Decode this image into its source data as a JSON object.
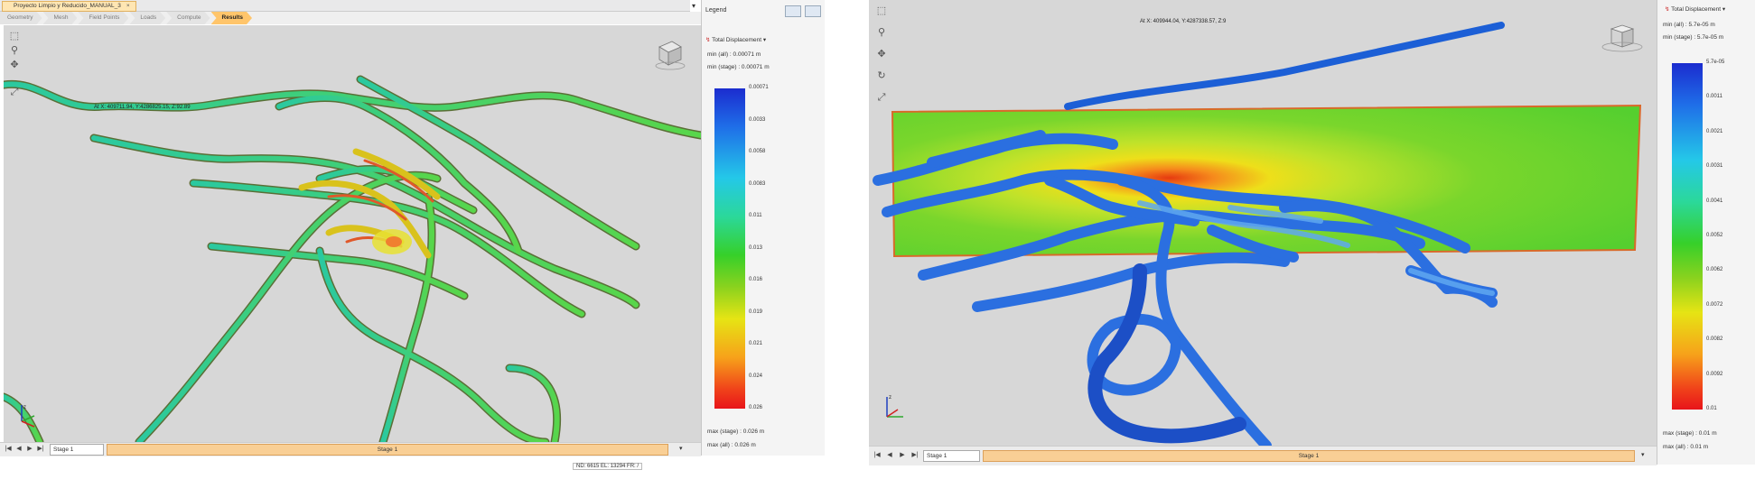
{
  "left": {
    "doc_tab": "Proyecto Limpio y Reducido_MANUAL_3",
    "doc_tab_close": "×",
    "workflow_tabs": [
      "Geometry",
      "Mesh",
      "Field Points",
      "Loads",
      "Compute",
      "Results"
    ],
    "active_tab": "Results",
    "coord_readout": "At X: 409711.94, Y:4286825.15, Z:92.89",
    "legend": {
      "title": "Legend",
      "quantity": "Total Displacement",
      "min_all": "min (all) :   0.00071 m",
      "min_stage": "min (stage) :  0.00071 m",
      "max_stage": "max (stage) :  0.026 m",
      "max_all": "max (all) :   0.026 m",
      "ticks": [
        "0.00071",
        "0.0033",
        "0.0058",
        "0.0083",
        "0.011",
        "0.013",
        "0.016",
        "0.019",
        "0.021",
        "0.024",
        "0.026"
      ]
    },
    "stage_select": "Stage 1",
    "timeline_label": "Stage 1",
    "status": "ND: 6615  EL: 13294  FR: /"
  },
  "right": {
    "coord_readout": "At X: 409944.04, Y:4287338.57, Z:9",
    "legend": {
      "quantity": "Total Displacement",
      "min_all": "min (all) :   5.7e-05 m",
      "min_stage": "min (stage) : 5.7e-05 m",
      "max_stage": "max (stage) :  0.01 m",
      "max_all": "max (all) :   0.01 m",
      "ticks": [
        "5.7e-05",
        "0.0011",
        "0.0021",
        "0.0031",
        "0.0041",
        "0.0052",
        "0.0062",
        "0.0072",
        "0.0082",
        "0.0092",
        "0.01"
      ]
    },
    "stage_select": "Stage 1",
    "timeline_label": "Stage 1"
  },
  "playback_icons": [
    "|◀",
    "◀",
    "▶",
    "▶|"
  ],
  "colors": {
    "viewport_bg": "#d7d7d7",
    "active_tab": "#ffc56b",
    "timeline": "#f9cf95"
  }
}
